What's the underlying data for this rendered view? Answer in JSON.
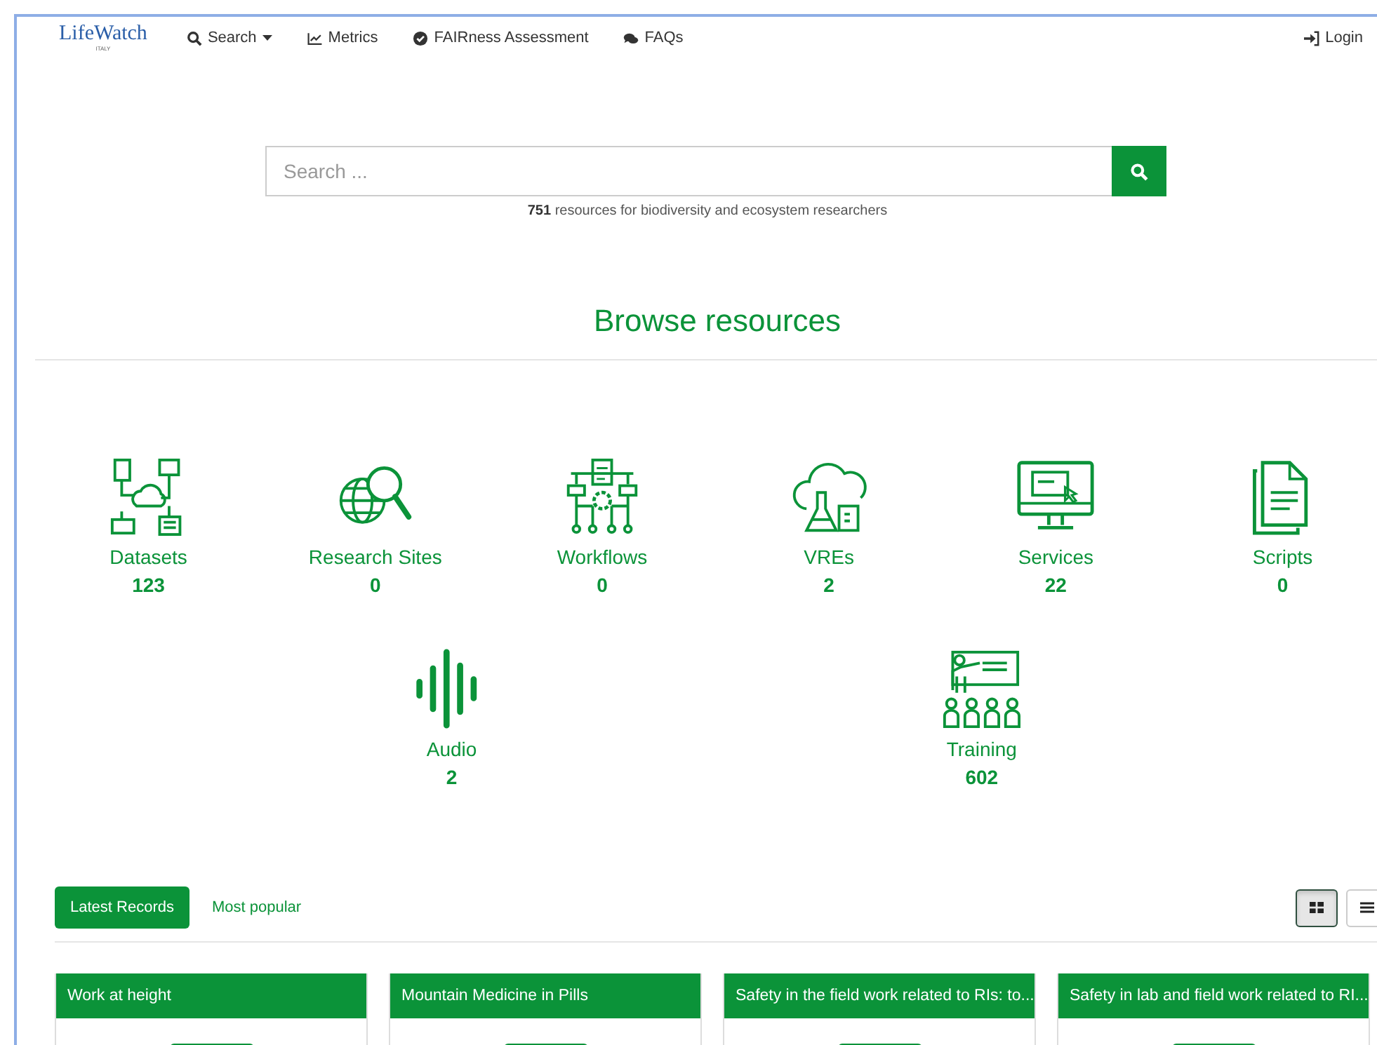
{
  "navbar": {
    "logo": {
      "text": "LifeWatch",
      "subtitle": "ITALY"
    },
    "items": [
      {
        "label": "Search",
        "dropdown": true
      },
      {
        "label": "Metrics",
        "dropdown": false
      },
      {
        "label": "FAIRness Assessment",
        "dropdown": false
      },
      {
        "label": "FAQs",
        "dropdown": false
      }
    ],
    "login": "Login"
  },
  "search": {
    "placeholder": "Search ...",
    "count": "751",
    "caption": "resources for biodiversity and ecosystem researchers"
  },
  "browse": {
    "title": "Browse resources",
    "resources": [
      {
        "label": "Datasets",
        "count": "123"
      },
      {
        "label": "Research Sites",
        "count": "0"
      },
      {
        "label": "Workflows",
        "count": "0"
      },
      {
        "label": "VREs",
        "count": "2"
      },
      {
        "label": "Services",
        "count": "22"
      },
      {
        "label": "Scripts",
        "count": "0"
      },
      {
        "label": "Audio",
        "count": "2"
      },
      {
        "label": "Training",
        "count": "602"
      }
    ]
  },
  "records": {
    "tabs": [
      {
        "label": "Latest Records",
        "selected": true
      },
      {
        "label": "Most popular",
        "selected": false
      }
    ],
    "views": [
      {
        "kind": "grid",
        "selected": true
      },
      {
        "kind": "list",
        "selected": false
      }
    ],
    "cards": [
      {
        "title": "Work at height"
      },
      {
        "title": "Mountain Medicine in Pills"
      },
      {
        "title": "Safety in the field work related to RIs: to..."
      },
      {
        "title": "Safety in lab and field work related to RI..."
      }
    ]
  }
}
